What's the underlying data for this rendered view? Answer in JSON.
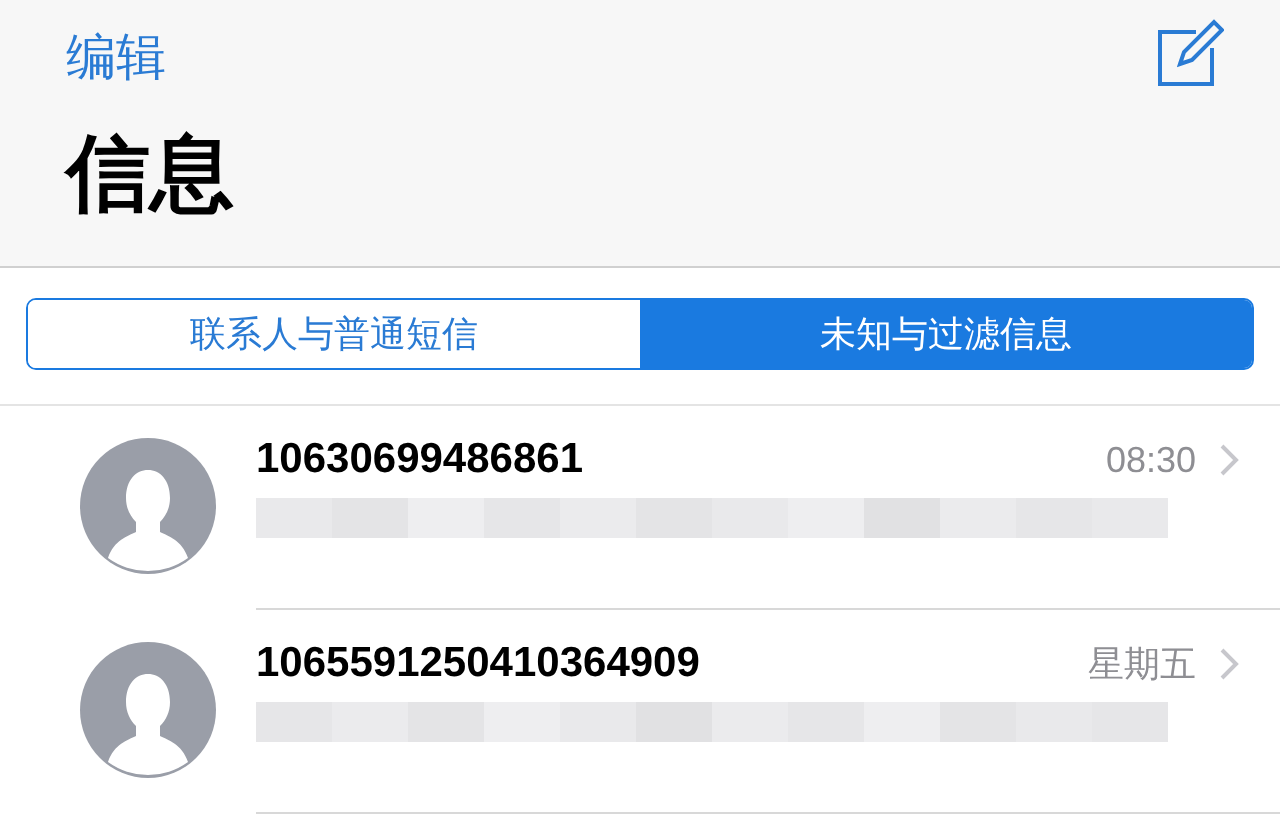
{
  "nav": {
    "edit": "编辑",
    "title": "信息"
  },
  "tabs": [
    {
      "label": "联系人与普通短信",
      "selected": false
    },
    {
      "label": "未知与过滤信息",
      "selected": true
    }
  ],
  "conversations": [
    {
      "sender": "10630699486861",
      "time": "08:30"
    },
    {
      "sender": "1065591250410364909",
      "time": "星期五"
    }
  ]
}
